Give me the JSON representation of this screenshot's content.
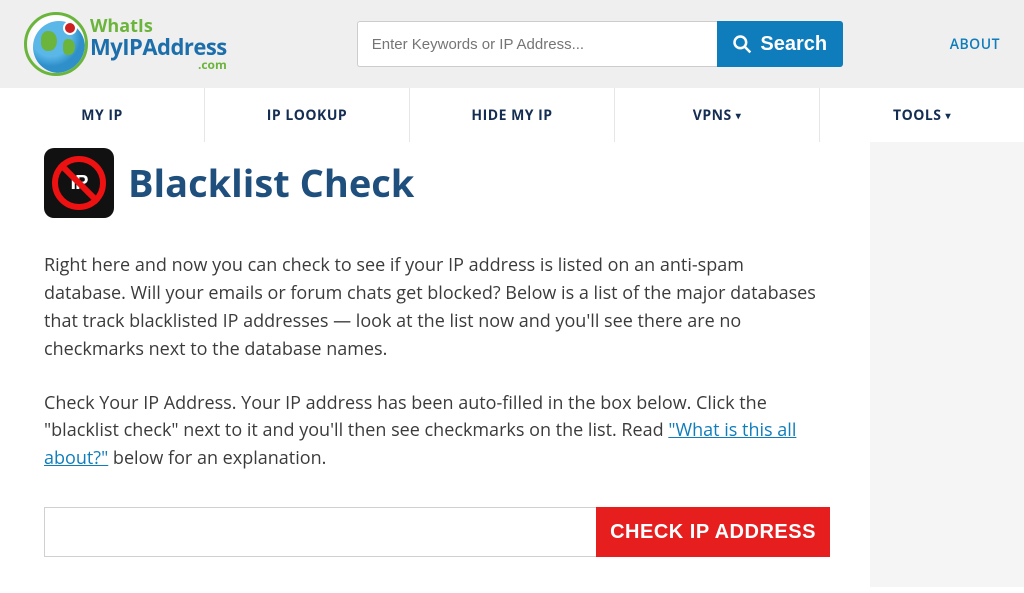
{
  "header": {
    "logo": {
      "line1": "WhatIs",
      "line2": "MyIPAddress",
      "line3": ".com"
    },
    "search": {
      "placeholder": "Enter Keywords or IP Address...",
      "button": "Search"
    },
    "about": "ABOUT"
  },
  "nav": {
    "items": [
      {
        "label": "MY IP",
        "dropdown": false
      },
      {
        "label": "IP LOOKUP",
        "dropdown": false
      },
      {
        "label": "HIDE MY IP",
        "dropdown": false
      },
      {
        "label": "VPNS",
        "dropdown": true
      },
      {
        "label": "TOOLS",
        "dropdown": true
      }
    ],
    "caret": "▾"
  },
  "page": {
    "title": "Blacklist Check",
    "icon_letters": "IP",
    "para1": "Right here and now you can check to see if your IP address is listed on an anti-spam database. Will your emails or forum chats get blocked? Below is a list of the major databases that track blacklisted IP addresses — look at the list now and you'll see there are no checkmarks next to the database names.",
    "para2a": "Check Your IP Address. Your IP address has been auto-filled in the box below. Click the \"blacklist check\" next to it and you'll then see checkmarks on the list. Read ",
    "para2_link": "\"What is this all about?\"",
    "para2b": " below for an explanation.",
    "ip_value": "",
    "check_button": "CHECK IP ADDRESS"
  }
}
